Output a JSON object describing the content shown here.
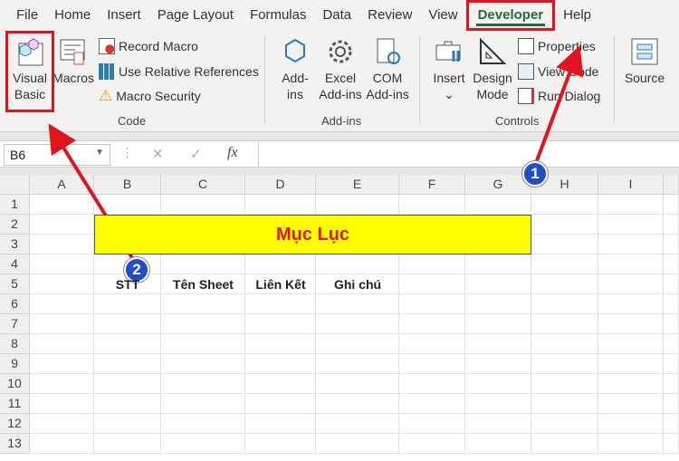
{
  "menu": [
    "File",
    "Home",
    "Insert",
    "Page Layout",
    "Formulas",
    "Data",
    "Review",
    "View",
    "Developer",
    "Help"
  ],
  "ribbon": {
    "visual_basic": [
      "Visual",
      "Basic"
    ],
    "macros": "Macros",
    "record_macro": "Record Macro",
    "relative_refs": "Use Relative References",
    "macro_security": "Macro Security",
    "code_group": "Code",
    "addins": [
      "Add-",
      "ins"
    ],
    "excel_addins": [
      "Excel",
      "Add-ins"
    ],
    "com_addins": [
      "COM",
      "Add-ins"
    ],
    "addins_group": "Add-ins",
    "insert": "Insert",
    "insert_caret": "⌄",
    "design_mode": [
      "Design",
      "Mode"
    ],
    "properties": "Properties",
    "view_code": "View Code",
    "run_dialog": "Run Dialog",
    "controls_group": "Controls",
    "source": "Source"
  },
  "formula_bar": {
    "name_box": "B6",
    "fx": "fx",
    "cancel": "✕",
    "enter": "✓",
    "value": ""
  },
  "columns": [
    "A",
    "B",
    "C",
    "D",
    "E",
    "F",
    "G",
    "H",
    "I"
  ],
  "rows": [
    "1",
    "2",
    "3",
    "4",
    "5",
    "6",
    "7",
    "8",
    "9",
    "10",
    "11",
    "12",
    "13"
  ],
  "sheet": {
    "title": "Mục Lục",
    "headers": [
      "STT",
      "Tên Sheet",
      "Liên Kết",
      "Ghi chú"
    ]
  },
  "annotations": {
    "step1": "1",
    "step2": "2"
  }
}
